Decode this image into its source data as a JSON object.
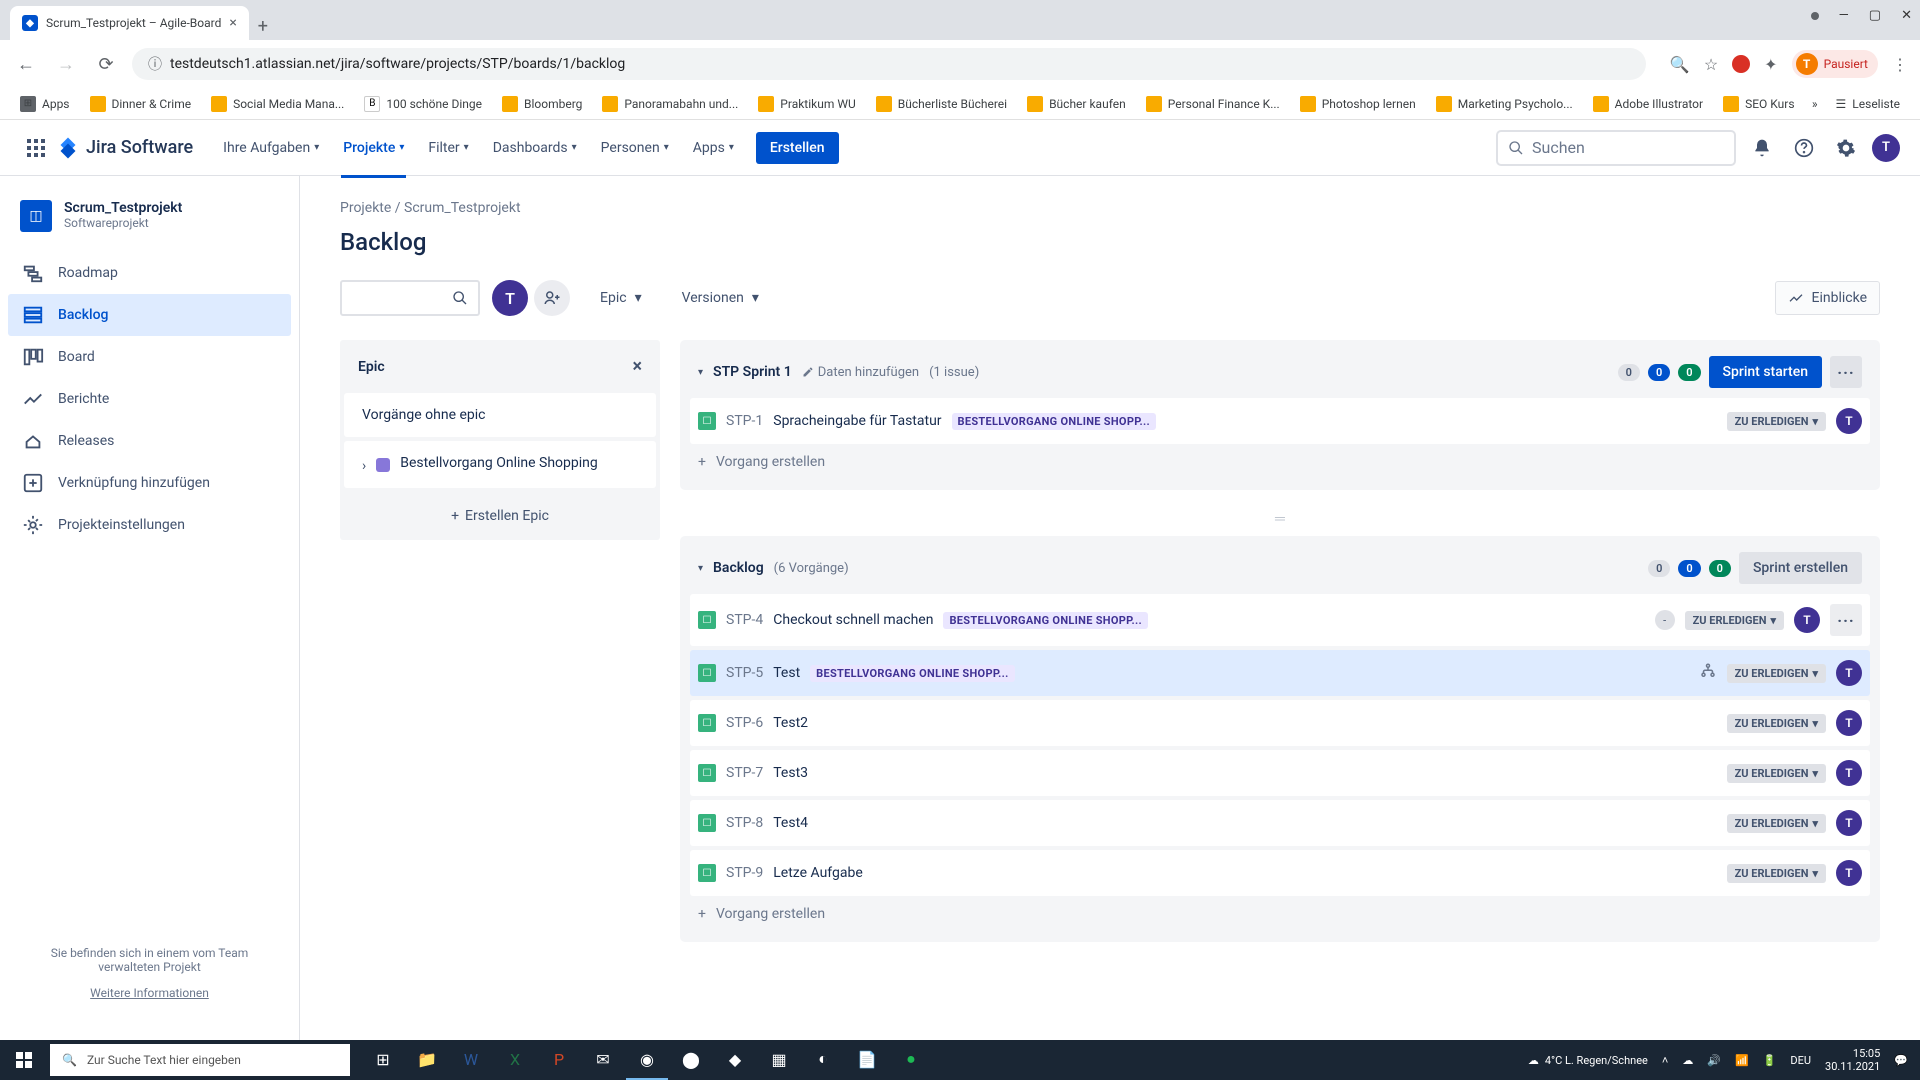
{
  "browser": {
    "tab_title": "Scrum_Testprojekt – Agile-Board",
    "url": "testdeutsch1.atlassian.net/jira/software/projects/STP/boards/1/backlog",
    "profile_label": "Pausiert",
    "window": {
      "minimize": "—",
      "maximize": "▢",
      "close": "✕"
    }
  },
  "bookmarks": [
    {
      "icon": "grid",
      "label": "Apps"
    },
    {
      "icon": "y",
      "label": "Dinner & Crime"
    },
    {
      "icon": "y",
      "label": "Social Media Mana..."
    },
    {
      "icon": "b",
      "label": "100 schöne Dinge"
    },
    {
      "icon": "y",
      "label": "Bloomberg"
    },
    {
      "icon": "y",
      "label": "Panoramabahn und..."
    },
    {
      "icon": "y",
      "label": "Praktikum WU"
    },
    {
      "icon": "y",
      "label": "Bücherliste Bücherei"
    },
    {
      "icon": "y",
      "label": "Bücher kaufen"
    },
    {
      "icon": "y",
      "label": "Personal Finance K..."
    },
    {
      "icon": "y",
      "label": "Photoshop lernen"
    },
    {
      "icon": "y",
      "label": "Marketing Psycholo..."
    },
    {
      "icon": "y",
      "label": "Adobe Illustrator"
    },
    {
      "icon": "y",
      "label": "SEO Kurs"
    }
  ],
  "bookmarks_overflow": "Leseliste",
  "jira_nav": {
    "logo_text": "Jira Software",
    "items": [
      {
        "label": "Ihre Aufgaben",
        "active": false
      },
      {
        "label": "Projekte",
        "active": true
      },
      {
        "label": "Filter",
        "active": false
      },
      {
        "label": "Dashboards",
        "active": false
      },
      {
        "label": "Personen",
        "active": false
      },
      {
        "label": "Apps",
        "active": false
      }
    ],
    "create_label": "Erstellen",
    "search_placeholder": "Suchen",
    "user_initial": "T"
  },
  "project": {
    "name": "Scrum_Testprojekt",
    "type": "Softwareprojekt"
  },
  "sidebar": {
    "items": [
      {
        "label": "Roadmap",
        "active": false
      },
      {
        "label": "Backlog",
        "active": true
      },
      {
        "label": "Board",
        "active": false
      },
      {
        "label": "Berichte",
        "active": false
      },
      {
        "label": "Releases",
        "active": false
      },
      {
        "label": "Verknüpfung hinzufügen",
        "active": false
      },
      {
        "label": "Projekteinstellungen",
        "active": false
      }
    ],
    "footer_text": "Sie befinden sich in einem vom Team verwalteten Projekt",
    "footer_link": "Weitere Informationen"
  },
  "breadcrumb": {
    "root": "Projekte",
    "sep": "/",
    "current": "Scrum_Testprojekt"
  },
  "page_title": "Backlog",
  "toolbar": {
    "epic_label": "Epic",
    "versions_label": "Versionen",
    "insights_label": "Einblicke",
    "user_initial": "T"
  },
  "epic_panel": {
    "title": "Epic",
    "no_epic": "Vorgänge ohne epic",
    "epic_name": "Bestellvorgang Online Shopping",
    "create_label": "Erstellen Epic"
  },
  "sprint": {
    "name": "STP Sprint 1",
    "add_dates": "Daten hinzufügen",
    "count": "(1 issue)",
    "pills": [
      "0",
      "0",
      "0"
    ],
    "start_label": "Sprint starten"
  },
  "issues_sprint": [
    {
      "key": "STP-1",
      "title": "Spracheingabe für Tastatur",
      "epic": "BESTELLVORGANG ONLINE SHOPP...",
      "status": "ZU ERLEDIGEN",
      "assignee": "T"
    }
  ],
  "create_issue_label": "Vorgang erstellen",
  "backlog_section": {
    "name": "Backlog",
    "count": "(6 Vorgänge)",
    "pills": [
      "0",
      "0",
      "0"
    ],
    "create_sprint_label": "Sprint erstellen"
  },
  "issues_backlog": [
    {
      "key": "STP-4",
      "title": "Checkout schnell machen",
      "epic": "BESTELLVORGANG ONLINE SHOPP...",
      "status": "ZU ERLEDIGEN",
      "assignee": "T",
      "estimate": "-",
      "more": true
    },
    {
      "key": "STP-5",
      "title": "Test",
      "epic": "BESTELLVORGANG ONLINE SHOPP...",
      "status": "ZU ERLEDIGEN",
      "assignee": "T",
      "child": true,
      "selected": true
    },
    {
      "key": "STP-6",
      "title": "Test2",
      "status": "ZU ERLEDIGEN",
      "assignee": "T"
    },
    {
      "key": "STP-7",
      "title": "Test3",
      "status": "ZU ERLEDIGEN",
      "assignee": "T"
    },
    {
      "key": "STP-8",
      "title": "Test4",
      "status": "ZU ERLEDIGEN",
      "assignee": "T"
    },
    {
      "key": "STP-9",
      "title": "Letze Aufgabe",
      "status": "ZU ERLEDIGEN",
      "assignee": "T"
    }
  ],
  "taskbar": {
    "search_placeholder": "Zur Suche Text hier eingeben",
    "weather": "4°C  L. Regen/Schnee",
    "lang": "DEU",
    "time": "15:05",
    "date": "30.11.2021"
  }
}
